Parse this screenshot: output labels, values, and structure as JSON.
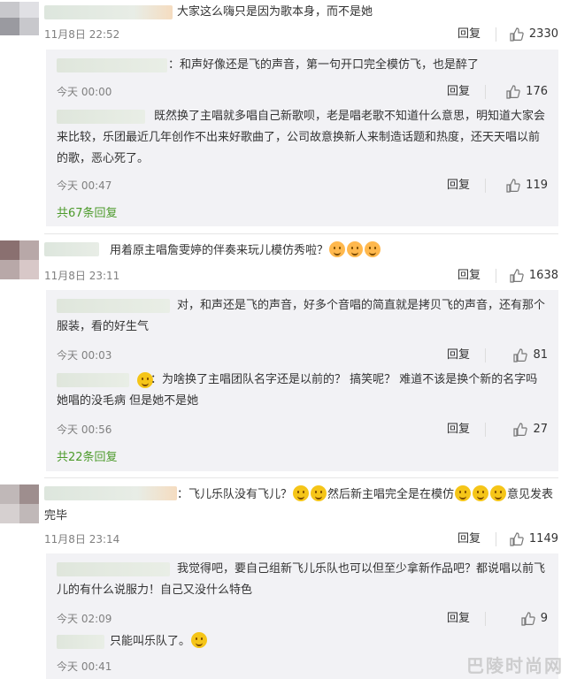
{
  "comments": [
    {
      "text": "大家这么嗨只是因为歌本身，而不是她",
      "time": "11月8日 22:52",
      "reply_label": "回复",
      "likes": "2330",
      "replies": [
        {
          "text": "：和声好像还是飞的声音，第一句开口完全模仿飞，也是醉了",
          "time": "今天 00:00",
          "reply_label": "回复",
          "likes": "176"
        },
        {
          "text": "既然换了主唱就多唱自己新歌呗，老是唱老歌不知道什么意思，明知道大家会来比较，乐团最近几年创作不出来好歌曲了，公司故意换新人来制造话题和热度，还天天唱以前的歌，恶心死了。",
          "time": "今天 00:47",
          "reply_label": "回复",
          "likes": "119"
        }
      ],
      "total_replies": "共67条回复"
    },
    {
      "text": "用着原主唱詹雯婷的伴奏来玩儿模仿秀啦？",
      "time": "11月8日 23:11",
      "reply_label": "回复",
      "likes": "1638",
      "replies": [
        {
          "text": "对，和声还是飞的声音，好多个音唱的简直就是拷贝飞的声音，还有那个服装，看的好生气",
          "time": "今天 00:03",
          "reply_label": "回复",
          "likes": "81"
        },
        {
          "text": "：为啥换了主唱团队名字还是以前的？ 搞笑呢？ 难道不该是换个新的名字吗 她唱的没毛病 但是她不是她",
          "time": "今天 00:56",
          "reply_label": "回复",
          "likes": "27"
        }
      ],
      "total_replies": "共22条回复"
    },
    {
      "text_a": "：飞儿乐队没有飞儿？",
      "text_b": "然后新主唱完全是在模仿",
      "text_c": "意见发表完毕",
      "time": "11月8日 23:14",
      "reply_label": "回复",
      "likes": "1149",
      "replies": [
        {
          "text": "我觉得吧，要自己组新飞儿乐队也可以但至少拿新作品吧？都说唱以前飞儿的有什么说服力！自己又没什么特色",
          "time": "今天 02:09",
          "reply_label": "回复",
          "likes": "9"
        },
        {
          "text": "只能叫乐队了。",
          "time": "今天 00:41",
          "reply_label": "回复",
          "likes": ""
        }
      ]
    }
  ],
  "watermark": "巴陵时尚网",
  "colors": {
    "reply_bg": "#f2f2f5",
    "total_link": "#4c9a2a",
    "meta_gray": "#808080"
  }
}
